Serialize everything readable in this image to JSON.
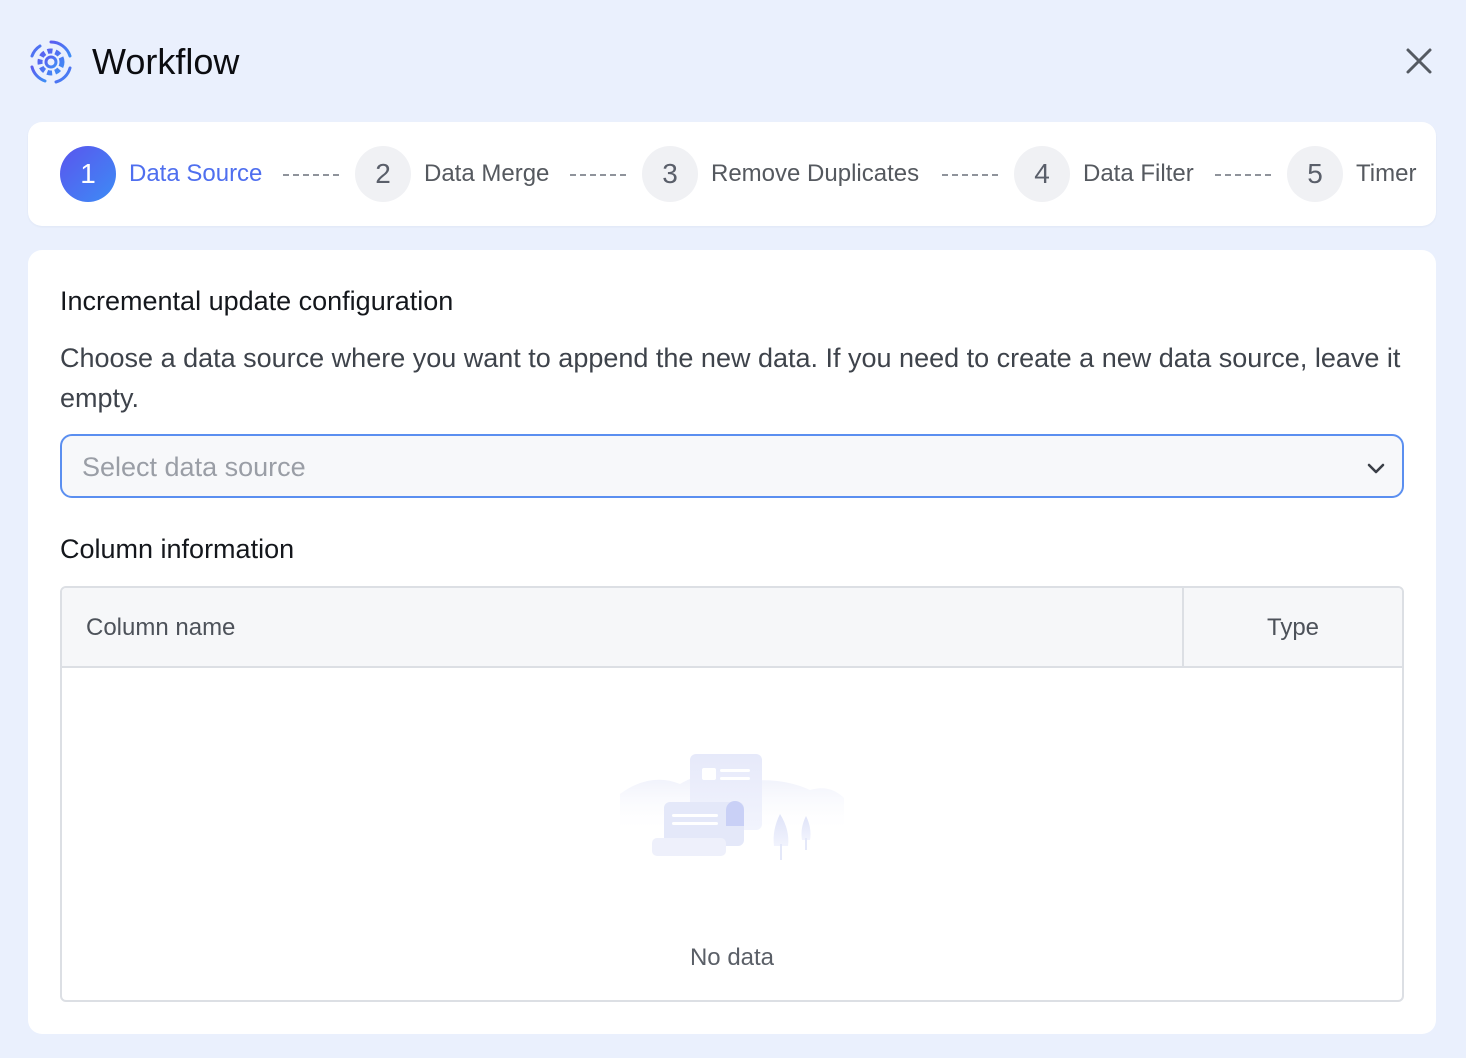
{
  "header": {
    "title": "Workflow",
    "app_icon": "workflow-gear-icon",
    "close_icon": "close-icon"
  },
  "steps": [
    {
      "number": "1",
      "label": "Data Source",
      "active": true
    },
    {
      "number": "2",
      "label": "Data Merge",
      "active": false
    },
    {
      "number": "3",
      "label": "Remove Duplicates",
      "active": false
    },
    {
      "number": "4",
      "label": "Data Filter",
      "active": false
    },
    {
      "number": "5",
      "label": "Timer",
      "active": false
    }
  ],
  "config": {
    "title": "Incremental update configuration",
    "description": "Choose a data source where you want to append the new data. If you need to create a new data source, leave it empty.",
    "select_placeholder": "Select data source",
    "select_value": ""
  },
  "columns": {
    "title": "Column information",
    "headers": [
      "Column name",
      "Type"
    ],
    "rows": [],
    "empty_text": "No data"
  },
  "colors": {
    "accent": "#4f6fef",
    "background": "#eaf0fd",
    "select_border": "#5b8ff0"
  }
}
